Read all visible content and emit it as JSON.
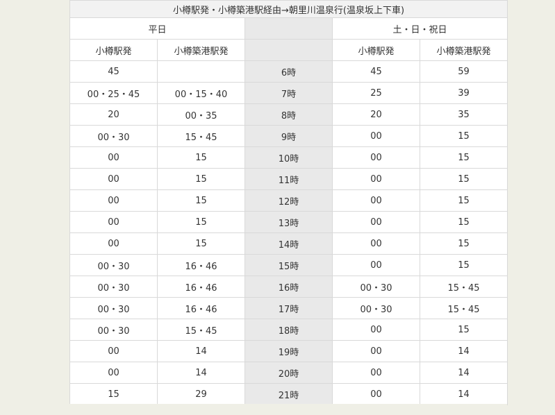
{
  "title": "小樽駅発・小樽築港駅経由→朝里川温泉行(温泉坂上下車)",
  "groups": {
    "weekday": "平日",
    "holiday": "土・日・祝日"
  },
  "columns": {
    "weekday_otaru": "小樽駅発",
    "weekday_chikko": "小樽築港駅発",
    "holiday_otaru": "小樽駅発",
    "holiday_chikko": "小樽築港駅発"
  },
  "rows": [
    {
      "hour": "6時",
      "wd_otaru": "45",
      "wd_chikko": "",
      "hd_otaru": "45",
      "hd_chikko": "59"
    },
    {
      "hour": "7時",
      "wd_otaru": "00・25・45",
      "wd_chikko": "00・15・40",
      "hd_otaru": "25",
      "hd_chikko": "39"
    },
    {
      "hour": "8時",
      "wd_otaru": "20",
      "wd_chikko": "00・35",
      "hd_otaru": "20",
      "hd_chikko": "35"
    },
    {
      "hour": "9時",
      "wd_otaru": "00・30",
      "wd_chikko": "15・45",
      "hd_otaru": "00",
      "hd_chikko": "15"
    },
    {
      "hour": "10時",
      "wd_otaru": "00",
      "wd_chikko": "15",
      "hd_otaru": "00",
      "hd_chikko": "15"
    },
    {
      "hour": "11時",
      "wd_otaru": "00",
      "wd_chikko": "15",
      "hd_otaru": "00",
      "hd_chikko": "15"
    },
    {
      "hour": "12時",
      "wd_otaru": "00",
      "wd_chikko": "15",
      "hd_otaru": "00",
      "hd_chikko": "15"
    },
    {
      "hour": "13時",
      "wd_otaru": "00",
      "wd_chikko": "15",
      "hd_otaru": "00",
      "hd_chikko": "15"
    },
    {
      "hour": "14時",
      "wd_otaru": "00",
      "wd_chikko": "15",
      "hd_otaru": "00",
      "hd_chikko": "15"
    },
    {
      "hour": "15時",
      "wd_otaru": "00・30",
      "wd_chikko": "16・46",
      "hd_otaru": "00",
      "hd_chikko": "15"
    },
    {
      "hour": "16時",
      "wd_otaru": "00・30",
      "wd_chikko": "16・46",
      "hd_otaru": "00・30",
      "hd_chikko": "15・45"
    },
    {
      "hour": "17時",
      "wd_otaru": "00・30",
      "wd_chikko": "16・46",
      "hd_otaru": "00・30",
      "hd_chikko": "15・45"
    },
    {
      "hour": "18時",
      "wd_otaru": "00・30",
      "wd_chikko": "15・45",
      "hd_otaru": "00",
      "hd_chikko": "15"
    },
    {
      "hour": "19時",
      "wd_otaru": "00",
      "wd_chikko": "14",
      "hd_otaru": "00",
      "hd_chikko": "14"
    },
    {
      "hour": "20時",
      "wd_otaru": "00",
      "wd_chikko": "14",
      "hd_otaru": "00",
      "hd_chikko": "14"
    },
    {
      "hour": "21時",
      "wd_otaru": "15",
      "wd_chikko": "29",
      "hd_otaru": "00",
      "hd_chikko": "14"
    }
  ],
  "colors": {
    "background": "#efefe6",
    "table_bg": "#ffffff",
    "hour_column_bg": "#e9e9e9",
    "border": "#d9d9d9",
    "text": "#333333"
  }
}
